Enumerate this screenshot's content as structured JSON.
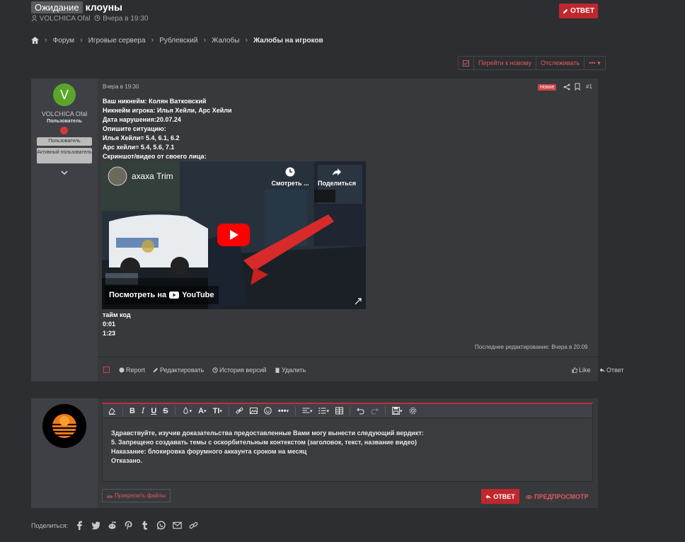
{
  "thread": {
    "prefix": "Ожидание",
    "title": "клоуны",
    "author": "VOLCHICA Ofal",
    "date": "Вчера в 19:30",
    "reply_button": "ОТВЕТ"
  },
  "breadcrumb": [
    "Форум",
    "Игровые сервера",
    "Рублевский",
    "Жалобы",
    "Жалобы на игроков"
  ],
  "actions": {
    "goto_new": "Перейти к новому",
    "watch": "Отслеживать",
    "more": "•••"
  },
  "post": {
    "user": {
      "avatar_letter": "V",
      "name": "VOLCHICA Ofal",
      "title": "Пользователь",
      "banners": [
        "Пользователь",
        "Активный пользователь"
      ]
    },
    "date": "Вчера в 19:30",
    "new_badge": "Новое",
    "number": "#1",
    "lines": [
      "Ваш никнейм: Колян Ватковский",
      "Никнейм игрока: Илья Хейли, Арс Хейли",
      "Дата нарушения:20.07.24",
      "Опишите ситуацию:",
      "Илья Хейли= 5.4, 6.1, 6.2",
      "Арс хейли= 5.4, 5.6, 7.1",
      "Скриншот/видео от своего лица:"
    ],
    "video": {
      "channel_title": "ахаха Trim",
      "watch_later": "Смотреть ...",
      "share": "Поделиться",
      "watch_on": "Посмотреть на",
      "youtube": "YouTube"
    },
    "after_lines": [
      "тайм код",
      "0:01",
      "1:23"
    ],
    "edited": "Последнее редактирование: Вчера в 20:09",
    "footer": {
      "report": "Report",
      "edit": "Редактировать",
      "history": "История версий",
      "delete": "Удалить",
      "like": "Like",
      "reply": "Ответ"
    }
  },
  "reply": {
    "text_lines": [
      "Здравствуйте, изучив доказательства предоставленные Вами могу вынести следующий вердикт:",
      "5. Запрещено создавать темы с оскорбительным контекстом (заголовок, текст, название видео)",
      "Наказание: блокировка форумного аккаунта сроком на месяц",
      "Отказано."
    ],
    "attach": "Прикрепить файлы",
    "send": "ОТВЕТ",
    "preview": "ПРЕДПРОСМОТР"
  },
  "share": {
    "label": "Поделиться:",
    "icons": [
      "facebook-icon",
      "twitter-icon",
      "reddit-icon",
      "pinterest-icon",
      "tumblr-icon",
      "whatsapp-icon",
      "email-icon",
      "link-icon"
    ]
  },
  "colors": {
    "accent": "#c0272d",
    "link_red": "#e05a5a",
    "background": "#2d2e32",
    "panel": "#38393d"
  }
}
